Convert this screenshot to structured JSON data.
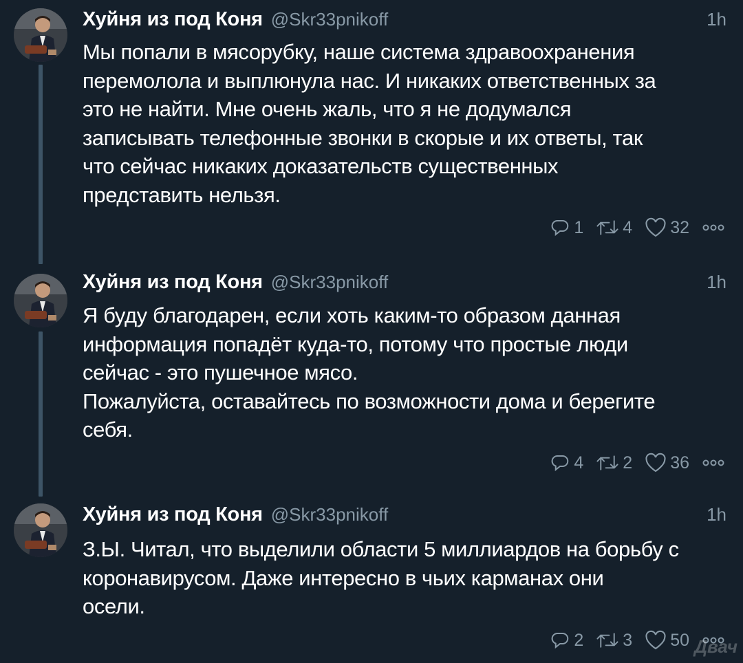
{
  "tweets": [
    {
      "author_name": "Хуйня из под Коня",
      "handle": "@Skr33pnikoff",
      "time": "1h",
      "text_lines": [
        "Мы попали в мясорубку, наше система здравоохранения",
        "перемолола и выплюнула нас. И никаких ответственных за",
        "это не найти. Мне очень жаль, что я не додумался",
        "записывать телефонные звонки в скорые и их ответы, так",
        "что сейчас никаких доказательств существенных",
        "представить нельзя."
      ],
      "replies": "1",
      "retweets": "4",
      "likes": "32"
    },
    {
      "author_name": "Хуйня из под Коня",
      "handle": "@Skr33pnikoff",
      "time": "1h",
      "text_lines": [
        "Я буду благодарен, если хоть каким-то образом данная",
        "информация попадёт куда-то, потому что простые люди",
        "сейчас - это пушечное мясо.",
        "Пожалуйста, оставайтесь по возможности дома и берегите",
        "себя."
      ],
      "replies": "4",
      "retweets": "2",
      "likes": "36"
    },
    {
      "author_name": "Хуйня из под Коня",
      "handle": "@Skr33pnikoff",
      "time": "1h",
      "text_lines": [
        "З.Ы. Читал, что выделили области 5 миллиардов на борьбу с",
        "коронавирусом. Даже интересно в чьих карманах они",
        "осели."
      ],
      "replies": "2",
      "retweets": "3",
      "likes": "50"
    }
  ],
  "watermark": "Двач",
  "icons": {
    "reply": "reply-icon",
    "retweet": "retweet-icon",
    "like": "heart-icon",
    "more": "more-icon"
  },
  "colors": {
    "background": "#15202b",
    "secondary_text": "#8899a6",
    "thread_line": "#3d5466"
  }
}
